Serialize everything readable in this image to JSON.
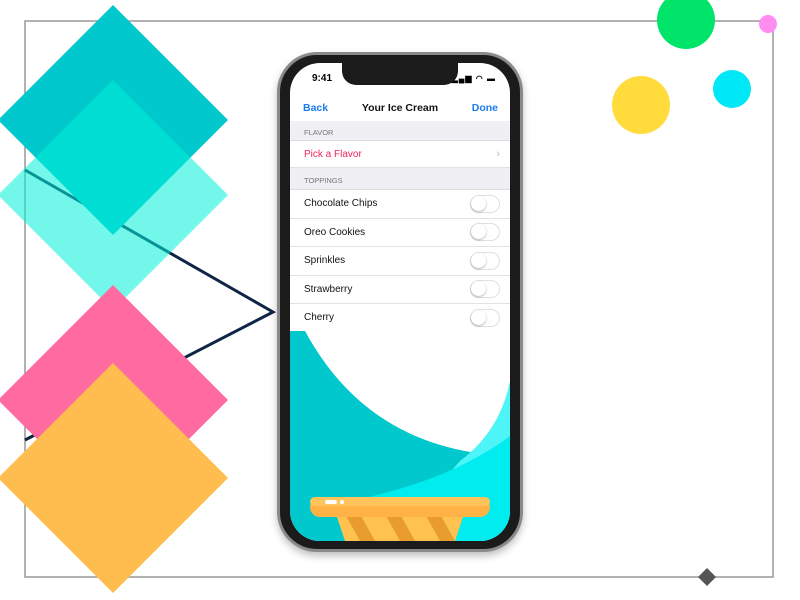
{
  "status": {
    "time": "9:41",
    "icons": "signal-icon wifi-icon battery-icon"
  },
  "nav": {
    "back": "Back",
    "title": "Your Ice Cream",
    "done": "Done"
  },
  "flavor": {
    "header": "FLAVOR",
    "pick": "Pick a Flavor",
    "pick_color": "#f0245a"
  },
  "toppings": {
    "header": "TOPPINGS",
    "items": [
      {
        "label": "Chocolate Chips",
        "on": false
      },
      {
        "label": "Oreo Cookies",
        "on": false
      },
      {
        "label": "Sprinkles",
        "on": false
      },
      {
        "label": "Strawberry",
        "on": false
      },
      {
        "label": "Cherry",
        "on": false
      }
    ]
  },
  "colors": {
    "accent": "#1a7cf0",
    "teal": "#00c8cc",
    "aqua": "#00f0e0",
    "pink": "#ff6aa0",
    "orange": "#ffbd4f",
    "green": "#00e46a",
    "yellow": "#ffdb3c",
    "cyan": "#00e8f5",
    "magenta": "#ff8cf0",
    "navy": "#0f2545"
  }
}
